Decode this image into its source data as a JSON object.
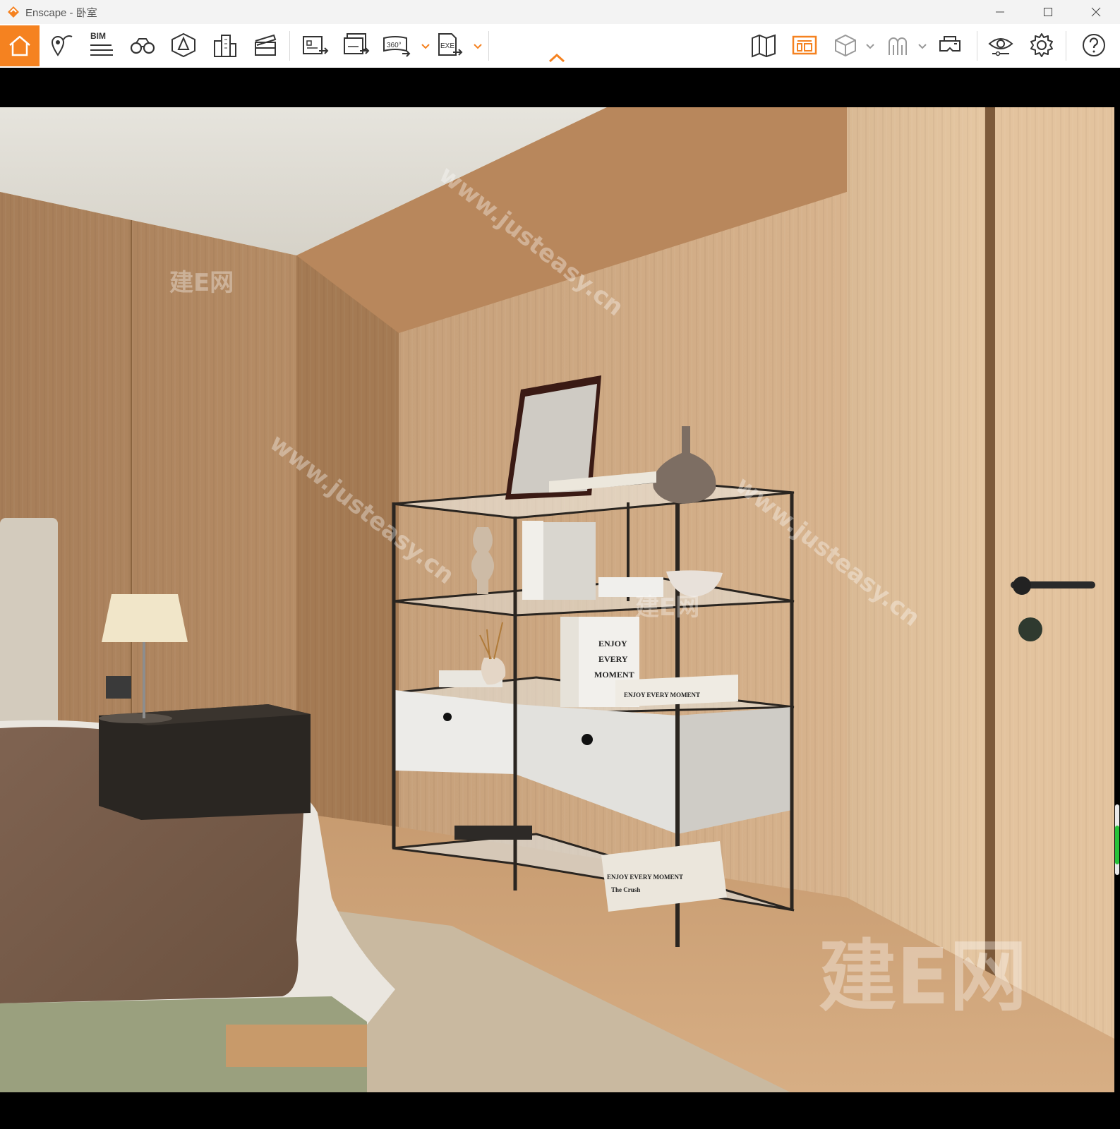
{
  "window": {
    "title": "Enscape - 卧室",
    "accent_color": "#f58220"
  },
  "toolbar": {
    "items": [
      {
        "name": "home",
        "icon": "home-icon",
        "active": true
      },
      {
        "name": "views",
        "icon": "location-pin-icon"
      },
      {
        "name": "bim",
        "icon": "bim-icon",
        "label": "BIM"
      },
      {
        "name": "walk-mode",
        "icon": "binoculars-icon"
      },
      {
        "name": "asset-library",
        "icon": "asset-icon"
      },
      {
        "name": "buildings",
        "icon": "buildings-icon"
      },
      {
        "name": "video-editor",
        "icon": "clapperboard-icon"
      },
      {
        "name": "render-image",
        "icon": "render-image-icon"
      },
      {
        "name": "batch-render",
        "icon": "batch-render-icon"
      },
      {
        "name": "panorama",
        "icon": "panorama-360-icon",
        "label": "360°"
      },
      {
        "name": "export-exe",
        "icon": "export-exe-icon",
        "label": "EXE"
      },
      {
        "name": "map",
        "icon": "map-icon"
      },
      {
        "name": "minimap",
        "icon": "minimap-icon",
        "active": true
      },
      {
        "name": "cube-views",
        "icon": "cube-icon"
      },
      {
        "name": "people",
        "icon": "people-icon"
      },
      {
        "name": "vr",
        "icon": "vr-headset-icon"
      },
      {
        "name": "visual-settings",
        "icon": "eye-settings-icon"
      },
      {
        "name": "settings",
        "icon": "gear-icon"
      },
      {
        "name": "help",
        "icon": "help-icon"
      }
    ]
  },
  "scene": {
    "books": [
      "ENJOY",
      "EVERY",
      "MOMENT",
      "ENJOY EVERY MOMENT",
      "The Crush"
    ],
    "watermarks": [
      "建E网",
      "www.justeasy.cn"
    ]
  }
}
